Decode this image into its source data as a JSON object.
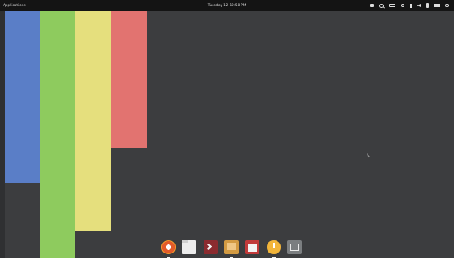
{
  "top_panel": {
    "applications_label": "Applications",
    "clock_text": "Tuesday 12 12:58 PM",
    "indicators": [
      {
        "name": "screenshot-icon"
      },
      {
        "name": "search-icon"
      },
      {
        "name": "keyboard-layout-icon"
      },
      {
        "name": "network-icon"
      },
      {
        "name": "bluetooth-icon"
      },
      {
        "name": "volume-icon"
      },
      {
        "name": "battery-icon"
      },
      {
        "name": "notifications-icon"
      },
      {
        "name": "power-icon"
      }
    ]
  },
  "desktop": {
    "bars": [
      {
        "name": "blue-bar",
        "color": "#5a7ec7"
      },
      {
        "name": "green-bar",
        "color": "#8ecb5e"
      },
      {
        "name": "yellow-bar",
        "color": "#e5df7d"
      },
      {
        "name": "red-bar",
        "color": "#e27370"
      }
    ],
    "background_color": "#3c3d3f"
  },
  "dock": {
    "items": [
      {
        "name": "firefox-icon",
        "running": true
      },
      {
        "name": "files-icon",
        "running": false
      },
      {
        "name": "terminal-icon",
        "running": false
      },
      {
        "name": "archive-manager-icon",
        "running": true
      },
      {
        "name": "calendar-icon",
        "running": false
      },
      {
        "name": "clock-icon",
        "running": true
      },
      {
        "name": "settings-icon",
        "running": false
      }
    ]
  }
}
